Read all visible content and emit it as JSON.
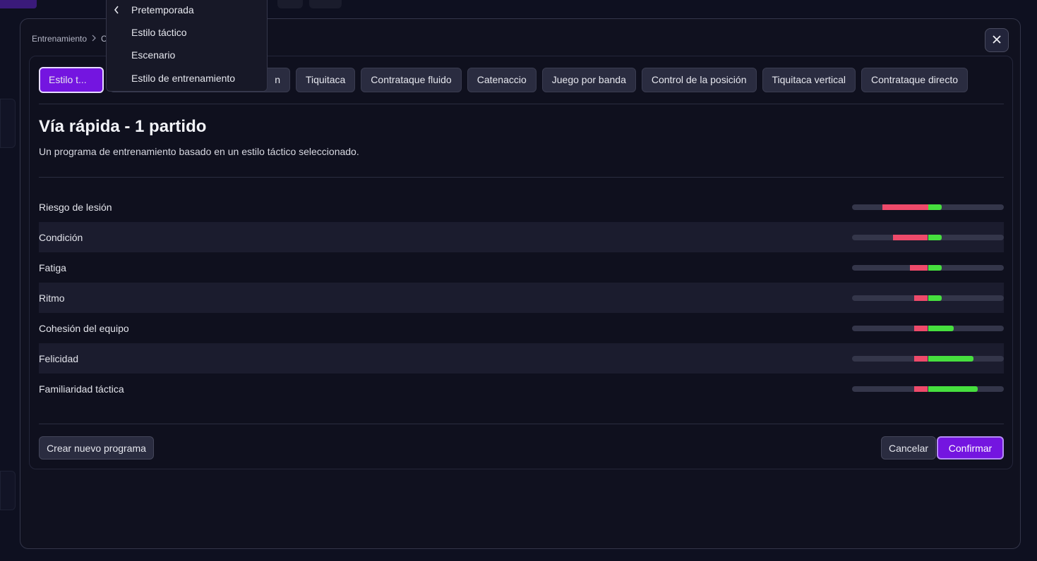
{
  "breadcrumb": {
    "root": "Entrenamiento",
    "separator": ">",
    "current": "C"
  },
  "dropdown": {
    "items": [
      "Pretemporada",
      "Estilo táctico",
      "Escenario",
      "Estilo de entrenamiento"
    ]
  },
  "tabs": {
    "active_label": "Estilo t...",
    "hidden_suffix": "n",
    "items": [
      "Tiquitaca",
      "Contrataque fluido",
      "Catenaccio",
      "Juego por banda",
      "Control de la posición",
      "Tiquitaca vertical",
      "Contrataque directo"
    ]
  },
  "program": {
    "title": "Vía rápida - 1 partido",
    "description": "Un programa de entrenamiento basado en un estilo táctico seleccionado."
  },
  "stats": [
    {
      "label": "Riesgo de lesión",
      "neg": 0.3,
      "pos": 0.09,
      "center": 0.5
    },
    {
      "label": "Condición",
      "neg": 0.23,
      "pos": 0.09,
      "center": 0.5
    },
    {
      "label": "Fatiga",
      "neg": 0.12,
      "pos": 0.09,
      "center": 0.5
    },
    {
      "label": "Ritmo",
      "neg": 0.09,
      "pos": 0.09,
      "center": 0.5
    },
    {
      "label": "Cohesión del equipo",
      "neg": 0.09,
      "pos": 0.17,
      "center": 0.5
    },
    {
      "label": "Felicidad",
      "neg": 0.09,
      "pos": 0.3,
      "center": 0.5
    },
    {
      "label": "Familiaridad táctica",
      "neg": 0.09,
      "pos": 0.33,
      "center": 0.5
    }
  ],
  "buttons": {
    "create": "Crear nuevo programa",
    "cancel": "Cancelar",
    "confirm": "Confirmar"
  },
  "colors": {
    "accent": "#7415e0",
    "negative": "#ee4a6a",
    "positive": "#46df3e"
  }
}
